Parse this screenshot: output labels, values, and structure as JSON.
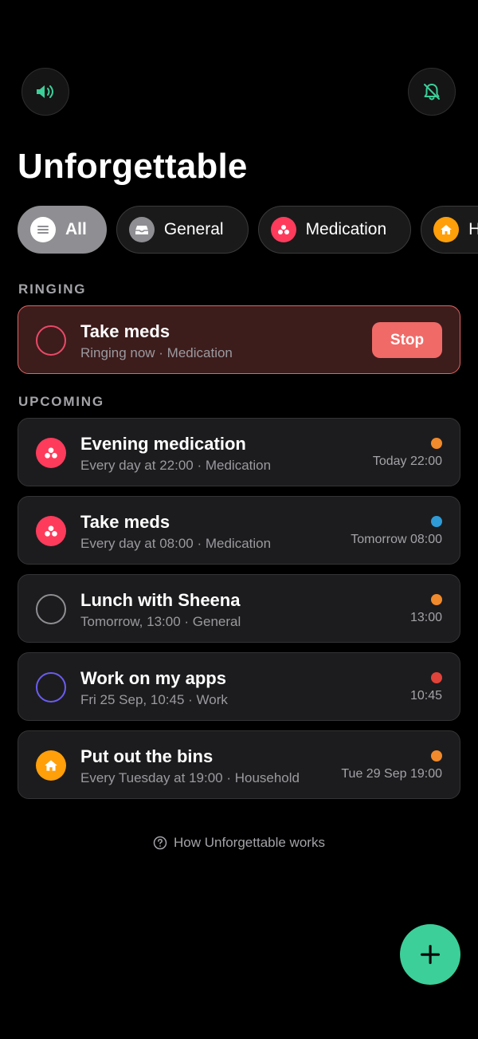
{
  "header": {
    "title": "Unforgettable",
    "sound_icon": "speaker-icon",
    "bell_icon": "bell-off-icon"
  },
  "categories": [
    {
      "label": "All",
      "icon": "list-icon",
      "color": "#ffffff",
      "active": true
    },
    {
      "label": "General",
      "icon": "tray-icon",
      "color": "#8e8e93",
      "active": false
    },
    {
      "label": "Medication",
      "icon": "pills-icon",
      "color": "#ff3b5c",
      "active": false
    },
    {
      "label": "Hou",
      "icon": "house-icon",
      "color": "#ff9f0a",
      "active": false
    }
  ],
  "ringing": {
    "section_title": "RINGING",
    "item": {
      "title": "Take meds",
      "subtitle": "Ringing now · Medication",
      "stop_label": "Stop",
      "accent": "#e94a67"
    }
  },
  "upcoming": {
    "section_title": "UPCOMING",
    "items": [
      {
        "title": "Evening medication",
        "subtitle": "Every day at 22:00 · Medication",
        "time": "Today 22:00",
        "dot": "#f08a2c",
        "icon": "pills-icon",
        "icon_color": "#ff3b5c"
      },
      {
        "title": "Take meds",
        "subtitle": "Every day at 08:00 · Medication",
        "time": "Tomorrow 08:00",
        "dot": "#2f9bd6",
        "icon": "pills-icon",
        "icon_color": "#ff3b5c"
      },
      {
        "title": "Lunch with Sheena",
        "subtitle": "Tomorrow, 13:00 · General",
        "time": "13:00",
        "dot": "#f08a2c",
        "icon": "circle-outline-icon",
        "icon_color": "#8e8e93"
      },
      {
        "title": "Work on my apps",
        "subtitle": "Fri 25 Sep, 10:45 · Work",
        "time": "10:45",
        "dot": "#e0433a",
        "icon": "circle-outline-icon",
        "icon_color": "#6a5cf0"
      },
      {
        "title": "Put out the bins",
        "subtitle": "Every Tuesday at 19:00 · Household",
        "time": "Tue 29 Sep 19:00",
        "dot": "#f08a2c",
        "icon": "house-icon",
        "icon_color": "#ff9f0a"
      }
    ]
  },
  "footer": {
    "help_label": "How Unforgettable works",
    "help_icon": "question-circle-icon"
  },
  "fab": {
    "icon": "plus-icon",
    "color": "#3ccf9a"
  }
}
